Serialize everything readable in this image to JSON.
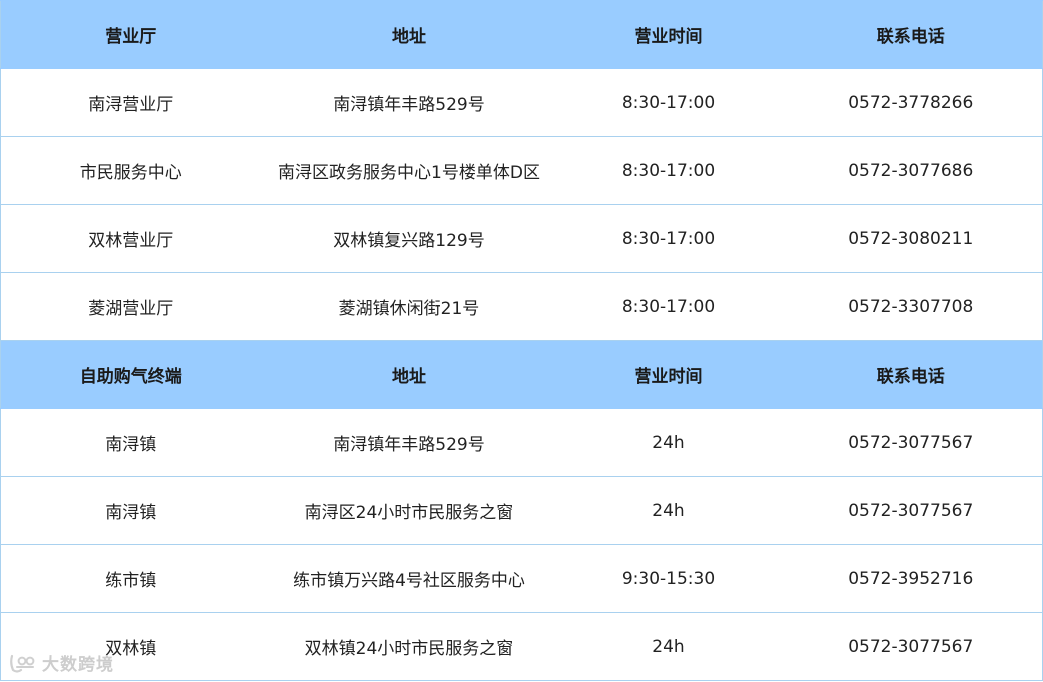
{
  "tables": [
    {
      "header": [
        "营业厅",
        "地址",
        "营业时间",
        "联系电话"
      ],
      "rows": [
        [
          "南浔营业厅",
          "南浔镇年丰路529号",
          "8:30-17:00",
          "0572-3778266"
        ],
        [
          "市民服务中心",
          "南浔区政务服务中心1号楼单体D区",
          "8:30-17:00",
          "0572-3077686"
        ],
        [
          "双林营业厅",
          "双林镇复兴路129号",
          "8:30-17:00",
          "0572-3080211"
        ],
        [
          "菱湖营业厅",
          "菱湖镇休闲街21号",
          "8:30-17:00",
          "0572-3307708"
        ]
      ]
    },
    {
      "header": [
        "自助购气终端",
        "地址",
        "营业时间",
        "联系电话"
      ],
      "rows": [
        [
          "南浔镇",
          "南浔镇年丰路529号",
          "24h",
          "0572-3077567"
        ],
        [
          "南浔镇",
          "南浔区24小时市民服务之窗",
          "24h",
          "0572-3077567"
        ],
        [
          "练市镇",
          "练市镇万兴路4号社区服务中心",
          "9:30-15:30",
          "0572-3952716"
        ],
        [
          "双林镇",
          "双林镇24小时市民服务之窗",
          "24h",
          "0572-3077567"
        ]
      ]
    }
  ],
  "colors": {
    "header_bg": "#99ccff",
    "border": "#a9d1ef"
  },
  "watermark": {
    "text": "大数跨境",
    "icon": "brand-logo-icon"
  }
}
